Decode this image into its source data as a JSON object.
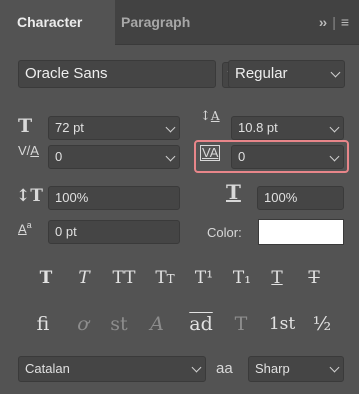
{
  "tabs": {
    "character": "Character",
    "paragraph": "Paragraph",
    "expand_icon": "double-chevron-right-icon",
    "menu_icon": "hamburger-menu-icon"
  },
  "font_family": "Oracle Sans",
  "font_style": "Regular",
  "font_size": "72 pt",
  "leading": "10.8 pt",
  "kerning": "0",
  "tracking": "0",
  "vertical_scale": "100%",
  "horizontal_scale": "100%",
  "baseline_shift": "0 pt",
  "color": {
    "label": "Color:",
    "value": "#ffffff"
  },
  "type_styles": [
    "T",
    "T",
    "TT",
    "Tt",
    "T¹",
    "T₁",
    "T",
    "T"
  ],
  "opentype_features": [
    "fi",
    "ơ",
    "st",
    "A",
    "ad",
    "T",
    "1st",
    "½"
  ],
  "language": "Catalan",
  "anti_alias_icon_label": "aa",
  "anti_alias": "Sharp",
  "colors": {
    "panel_bg": "#535353",
    "field_bg": "#454545",
    "highlight": "#e8868a"
  }
}
